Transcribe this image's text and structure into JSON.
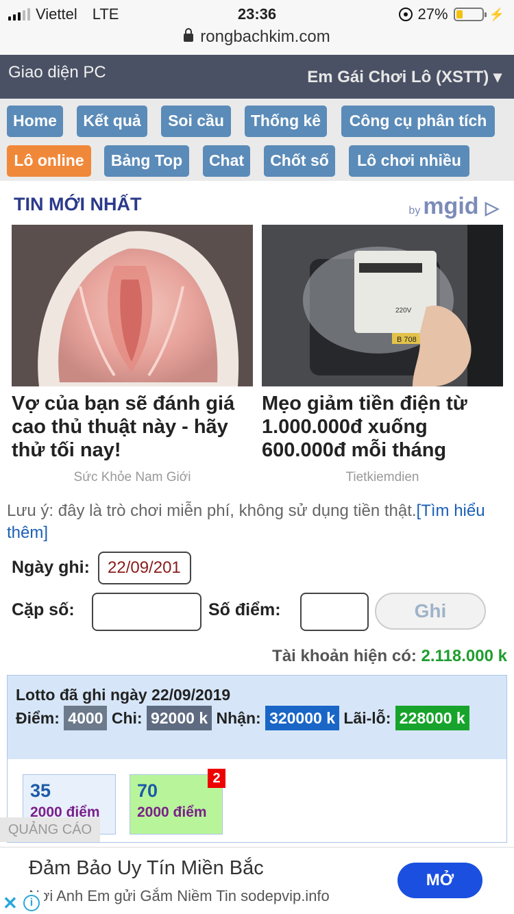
{
  "status_bar": {
    "carrier": "Viettel",
    "network": "LTE",
    "time": "23:36",
    "battery": "27%",
    "battery_level": 0.27
  },
  "browser": {
    "url": "rongbachkim.com"
  },
  "header": {
    "pc_link": "Giao diện PC",
    "room": "Em Gái Chơi Lô (XSTT) ▾"
  },
  "nav": [
    "Home",
    "Kết quả",
    "Soi cầu",
    "Thống kê",
    "Công cụ phân tích",
    "Lô online",
    "Bảng Top",
    "Chat",
    "Chốt số",
    "Lô chơi nhiều"
  ],
  "news": {
    "title": "TIN MỚI NHẤT",
    "provider_by": "by",
    "provider": "mgid",
    "cards": [
      {
        "headline": "Vợ của bạn sẽ đánh giá cao thủ thuật này - hãy thử tối nay!",
        "source": "Sức Khỏe Nam Giới"
      },
      {
        "headline": "Mẹo giảm tiền điện từ 1.000.000đ xuống 600.000đ mỗi tháng",
        "source": "Tietkiemdien"
      }
    ],
    "meter_label": "B 708"
  },
  "note": {
    "text": "Lưu ý: đây là trò chơi miễn phí, không sử dụng tiền thật.",
    "link": "[Tìm hiểu thêm]"
  },
  "form": {
    "date_label": "Ngày ghi:",
    "date_value": "22/09/201",
    "pair_label": "Cặp số:",
    "points_label": "Số điểm:",
    "submit": "Ghi"
  },
  "balance": {
    "label": "Tài khoản hiện có:",
    "value": "2.118.000 k"
  },
  "bets": {
    "heading": "Lotto đã ghi ngày 22/09/2019",
    "diem_label": "Điểm:",
    "diem": "4000",
    "chi_label": "Chi:",
    "chi": "92000 k",
    "nhan_label": "Nhận:",
    "nhan": "320000 k",
    "lai_label": "Lãi-lỗ:",
    "lai": "228000 k",
    "items": [
      {
        "number": "35",
        "points": "2000 điểm"
      },
      {
        "number": "70",
        "points": "2000 điểm"
      }
    ],
    "badge": "2"
  },
  "ad": {
    "label": "QUẢNG CÁO",
    "title": "Đảm Bảo Uy Tín Miền Bắc",
    "subtitle": "Nơi Anh Em gửi Gắm Niềm Tin sodepvip.info",
    "button": "MỞ"
  },
  "colors": {
    "header_bg": "#4a5164",
    "nav_button": "#5b8bb8",
    "nav_active": "#f0883a",
    "accent_green": "#1f9d2f"
  }
}
